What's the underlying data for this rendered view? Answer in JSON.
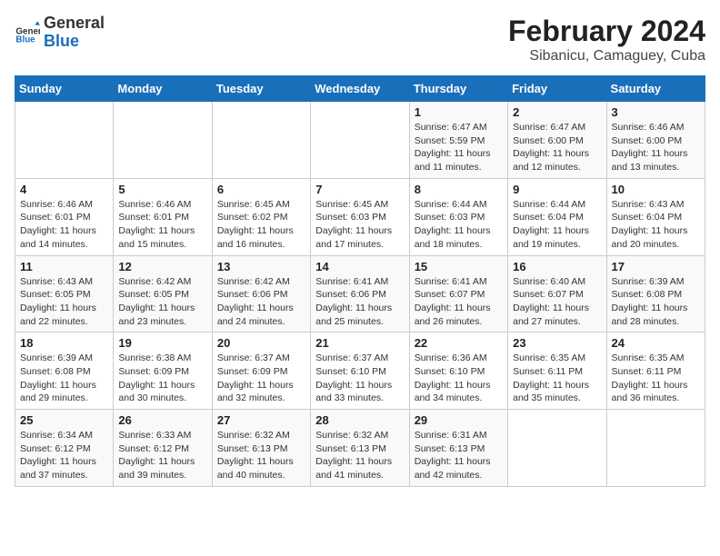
{
  "header": {
    "logo_text_general": "General",
    "logo_text_blue": "Blue",
    "month_year": "February 2024",
    "location": "Sibanicu, Camaguey, Cuba"
  },
  "weekdays": [
    "Sunday",
    "Monday",
    "Tuesday",
    "Wednesday",
    "Thursday",
    "Friday",
    "Saturday"
  ],
  "weeks": [
    [
      {
        "day": "",
        "info": ""
      },
      {
        "day": "",
        "info": ""
      },
      {
        "day": "",
        "info": ""
      },
      {
        "day": "",
        "info": ""
      },
      {
        "day": "1",
        "info": "Sunrise: 6:47 AM\nSunset: 5:59 PM\nDaylight: 11 hours and 11 minutes."
      },
      {
        "day": "2",
        "info": "Sunrise: 6:47 AM\nSunset: 6:00 PM\nDaylight: 11 hours and 12 minutes."
      },
      {
        "day": "3",
        "info": "Sunrise: 6:46 AM\nSunset: 6:00 PM\nDaylight: 11 hours and 13 minutes."
      }
    ],
    [
      {
        "day": "4",
        "info": "Sunrise: 6:46 AM\nSunset: 6:01 PM\nDaylight: 11 hours and 14 minutes."
      },
      {
        "day": "5",
        "info": "Sunrise: 6:46 AM\nSunset: 6:01 PM\nDaylight: 11 hours and 15 minutes."
      },
      {
        "day": "6",
        "info": "Sunrise: 6:45 AM\nSunset: 6:02 PM\nDaylight: 11 hours and 16 minutes."
      },
      {
        "day": "7",
        "info": "Sunrise: 6:45 AM\nSunset: 6:03 PM\nDaylight: 11 hours and 17 minutes."
      },
      {
        "day": "8",
        "info": "Sunrise: 6:44 AM\nSunset: 6:03 PM\nDaylight: 11 hours and 18 minutes."
      },
      {
        "day": "9",
        "info": "Sunrise: 6:44 AM\nSunset: 6:04 PM\nDaylight: 11 hours and 19 minutes."
      },
      {
        "day": "10",
        "info": "Sunrise: 6:43 AM\nSunset: 6:04 PM\nDaylight: 11 hours and 20 minutes."
      }
    ],
    [
      {
        "day": "11",
        "info": "Sunrise: 6:43 AM\nSunset: 6:05 PM\nDaylight: 11 hours and 22 minutes."
      },
      {
        "day": "12",
        "info": "Sunrise: 6:42 AM\nSunset: 6:05 PM\nDaylight: 11 hours and 23 minutes."
      },
      {
        "day": "13",
        "info": "Sunrise: 6:42 AM\nSunset: 6:06 PM\nDaylight: 11 hours and 24 minutes."
      },
      {
        "day": "14",
        "info": "Sunrise: 6:41 AM\nSunset: 6:06 PM\nDaylight: 11 hours and 25 minutes."
      },
      {
        "day": "15",
        "info": "Sunrise: 6:41 AM\nSunset: 6:07 PM\nDaylight: 11 hours and 26 minutes."
      },
      {
        "day": "16",
        "info": "Sunrise: 6:40 AM\nSunset: 6:07 PM\nDaylight: 11 hours and 27 minutes."
      },
      {
        "day": "17",
        "info": "Sunrise: 6:39 AM\nSunset: 6:08 PM\nDaylight: 11 hours and 28 minutes."
      }
    ],
    [
      {
        "day": "18",
        "info": "Sunrise: 6:39 AM\nSunset: 6:08 PM\nDaylight: 11 hours and 29 minutes."
      },
      {
        "day": "19",
        "info": "Sunrise: 6:38 AM\nSunset: 6:09 PM\nDaylight: 11 hours and 30 minutes."
      },
      {
        "day": "20",
        "info": "Sunrise: 6:37 AM\nSunset: 6:09 PM\nDaylight: 11 hours and 32 minutes."
      },
      {
        "day": "21",
        "info": "Sunrise: 6:37 AM\nSunset: 6:10 PM\nDaylight: 11 hours and 33 minutes."
      },
      {
        "day": "22",
        "info": "Sunrise: 6:36 AM\nSunset: 6:10 PM\nDaylight: 11 hours and 34 minutes."
      },
      {
        "day": "23",
        "info": "Sunrise: 6:35 AM\nSunset: 6:11 PM\nDaylight: 11 hours and 35 minutes."
      },
      {
        "day": "24",
        "info": "Sunrise: 6:35 AM\nSunset: 6:11 PM\nDaylight: 11 hours and 36 minutes."
      }
    ],
    [
      {
        "day": "25",
        "info": "Sunrise: 6:34 AM\nSunset: 6:12 PM\nDaylight: 11 hours and 37 minutes."
      },
      {
        "day": "26",
        "info": "Sunrise: 6:33 AM\nSunset: 6:12 PM\nDaylight: 11 hours and 39 minutes."
      },
      {
        "day": "27",
        "info": "Sunrise: 6:32 AM\nSunset: 6:13 PM\nDaylight: 11 hours and 40 minutes."
      },
      {
        "day": "28",
        "info": "Sunrise: 6:32 AM\nSunset: 6:13 PM\nDaylight: 11 hours and 41 minutes."
      },
      {
        "day": "29",
        "info": "Sunrise: 6:31 AM\nSunset: 6:13 PM\nDaylight: 11 hours and 42 minutes."
      },
      {
        "day": "",
        "info": ""
      },
      {
        "day": "",
        "info": ""
      }
    ]
  ]
}
